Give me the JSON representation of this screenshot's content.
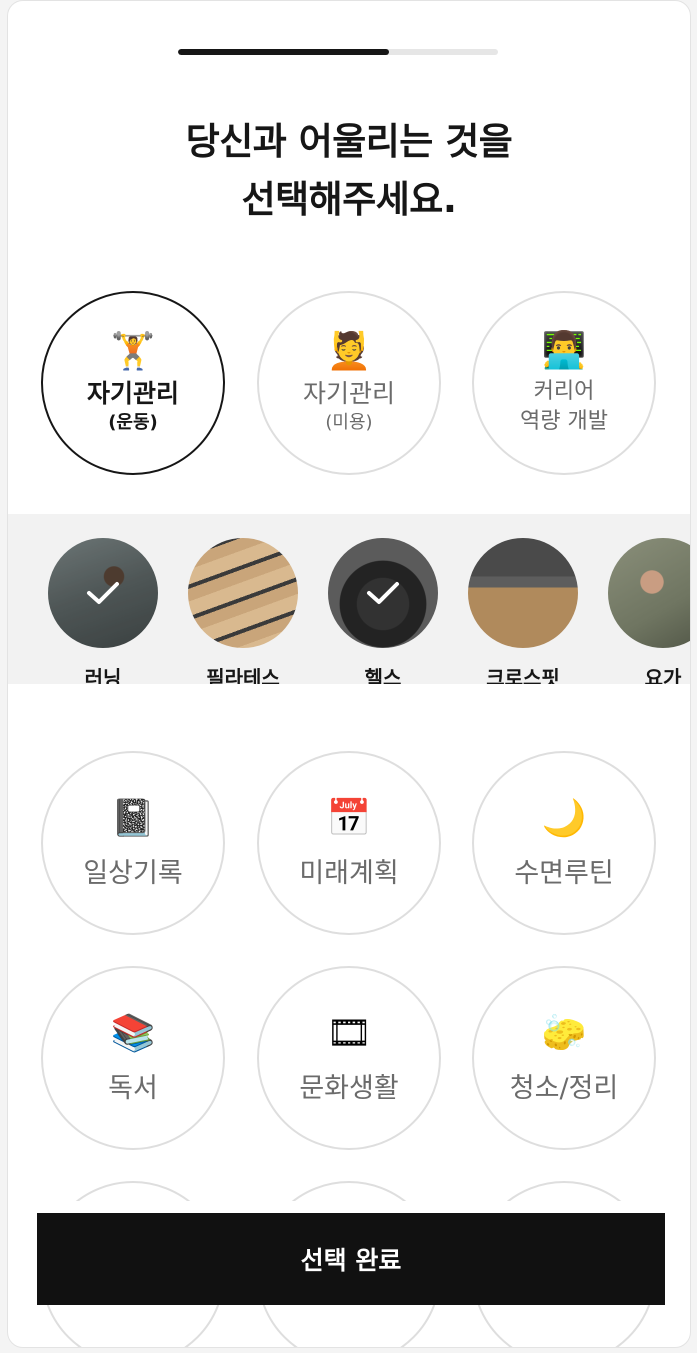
{
  "progress": {
    "fraction": 0.66
  },
  "title": {
    "line1": "당신과 어울리는 것을",
    "line2": "선택해주세요."
  },
  "categories": [
    {
      "emoji": "🏋",
      "label": "자기관리",
      "sub": "(운동)",
      "selected": true
    },
    {
      "emoji": "💆",
      "label": "자기관리",
      "sub": "(미용)",
      "selected": false
    },
    {
      "emoji": "👨‍💻",
      "label": "커리어",
      "sub": "역량 개발",
      "selected": false
    }
  ],
  "subcategories": [
    {
      "label": "러닝",
      "checked": true
    },
    {
      "label": "필라테스",
      "checked": false
    },
    {
      "label": "헬스",
      "checked": true
    },
    {
      "label": "크로스핏",
      "checked": false
    },
    {
      "label": "요가",
      "checked": false
    }
  ],
  "more_categories": [
    {
      "emoji": "📓",
      "label": "일상기록"
    },
    {
      "emoji": "📅",
      "label": "미래계획"
    },
    {
      "emoji": "🌙",
      "label": "수면루틴"
    },
    {
      "emoji": "📚",
      "label": "독서"
    },
    {
      "emoji": "🎞",
      "label": "문화생활"
    },
    {
      "emoji": "🧽",
      "label": "청소/정리"
    }
  ],
  "cta": {
    "label": "선택 완료"
  },
  "colors": {
    "accent": "#111111",
    "border": "#dedede",
    "muted": "#6b6b6b"
  }
}
